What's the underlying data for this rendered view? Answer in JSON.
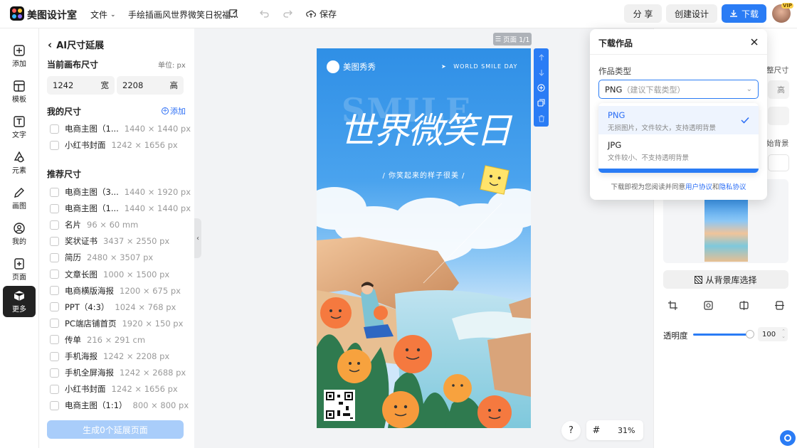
{
  "topbar": {
    "app_name": "美图设计室",
    "file_menu": "文件",
    "doc_title": "手绘插画风世界微笑日祝福...",
    "save_label": "保存",
    "share_label": "分 享",
    "create_label": "创建设计",
    "download_label": "下载",
    "avatar_badge": "VIP"
  },
  "rail": [
    {
      "label": "添加",
      "icon": "plus-square-icon"
    },
    {
      "label": "模板",
      "icon": "template-icon"
    },
    {
      "label": "文字",
      "icon": "text-icon"
    },
    {
      "label": "元素",
      "icon": "shapes-icon"
    },
    {
      "label": "画图",
      "icon": "draw-icon"
    },
    {
      "label": "我的",
      "icon": "user-icon"
    },
    {
      "label": "页面",
      "icon": "page-add-icon"
    },
    {
      "label": "更多",
      "icon": "cube-icon"
    }
  ],
  "panel": {
    "back_title": "AI尺寸延展",
    "current_size_label": "当前画布尺寸",
    "unit_label": "单位: px",
    "width_value": "1242",
    "width_unit": "宽",
    "height_value": "2208",
    "height_unit": "高",
    "my_sizes_label": "我的尺寸",
    "add_label": "添加",
    "my_sizes": [
      {
        "name": "电商主图（1...",
        "dims": "1440 × 1440 px"
      },
      {
        "name": "小红书封面",
        "dims": "1242 × 1656 px"
      }
    ],
    "recommended_label": "推荐尺寸",
    "recommended": [
      {
        "name": "电商主图（3...",
        "dims": "1440 × 1920 px"
      },
      {
        "name": "电商主图（1...",
        "dims": "1440 × 1440 px"
      },
      {
        "name": "名片",
        "dims": "96 × 60 mm"
      },
      {
        "name": "奖状证书",
        "dims": "3437 × 2550 px"
      },
      {
        "name": "简历",
        "dims": "2480 × 3507 px"
      },
      {
        "name": "文章长图",
        "dims": "1000 × 1500 px"
      },
      {
        "name": "电商横版海报",
        "dims": "1200 × 675 px"
      },
      {
        "name": "PPT（4:3）",
        "dims": "1024 × 768 px"
      },
      {
        "name": "PC端店铺首页",
        "dims": "1920 × 150 px"
      },
      {
        "name": "传单",
        "dims": "216 × 291 cm"
      },
      {
        "name": "手机海报",
        "dims": "1242 × 2208 px"
      },
      {
        "name": "手机全屏海报",
        "dims": "1242 × 2688 px"
      },
      {
        "name": "小红书封面",
        "dims": "1242 × 1656 px"
      },
      {
        "name": "电商主图（1:1）",
        "dims": "800 × 800 px"
      }
    ],
    "generate_button": "生成0个延展页面"
  },
  "canvas": {
    "page_badge": "页面 1/1",
    "zoom": "31%",
    "help": "?"
  },
  "poster": {
    "brand": "美图秀秀",
    "event": "WORLD SMILE DAY",
    "bg_word": "SMILE",
    "headline": "世界微笑日",
    "subtitle": "/ 你笑起来的样子很美 /"
  },
  "download": {
    "title": "下载作品",
    "type_label": "作品类型",
    "selected": "PNG",
    "selected_hint": "（建议下载类型）",
    "options": [
      {
        "name": "PNG",
        "desc": "无损图片，文件较大，支持透明背景"
      },
      {
        "name": "JPG",
        "desc": "文件较小、不支持透明背景"
      }
    ],
    "agree_text": "下载即视为您阅读并同意",
    "user_agreement": "用户协议",
    "and": "和",
    "privacy": "隐私协议"
  },
  "right": {
    "partial1": "整尺寸",
    "partial2": "高",
    "partial3": "始背景",
    "bg_lib_button": "从背景库选择",
    "opacity_label": "透明度",
    "opacity_value": "100",
    "opacity_fraction": 1.0
  },
  "colors": {
    "brand_blue": "#2a7cf5",
    "accent_link": "#2a6df5"
  }
}
